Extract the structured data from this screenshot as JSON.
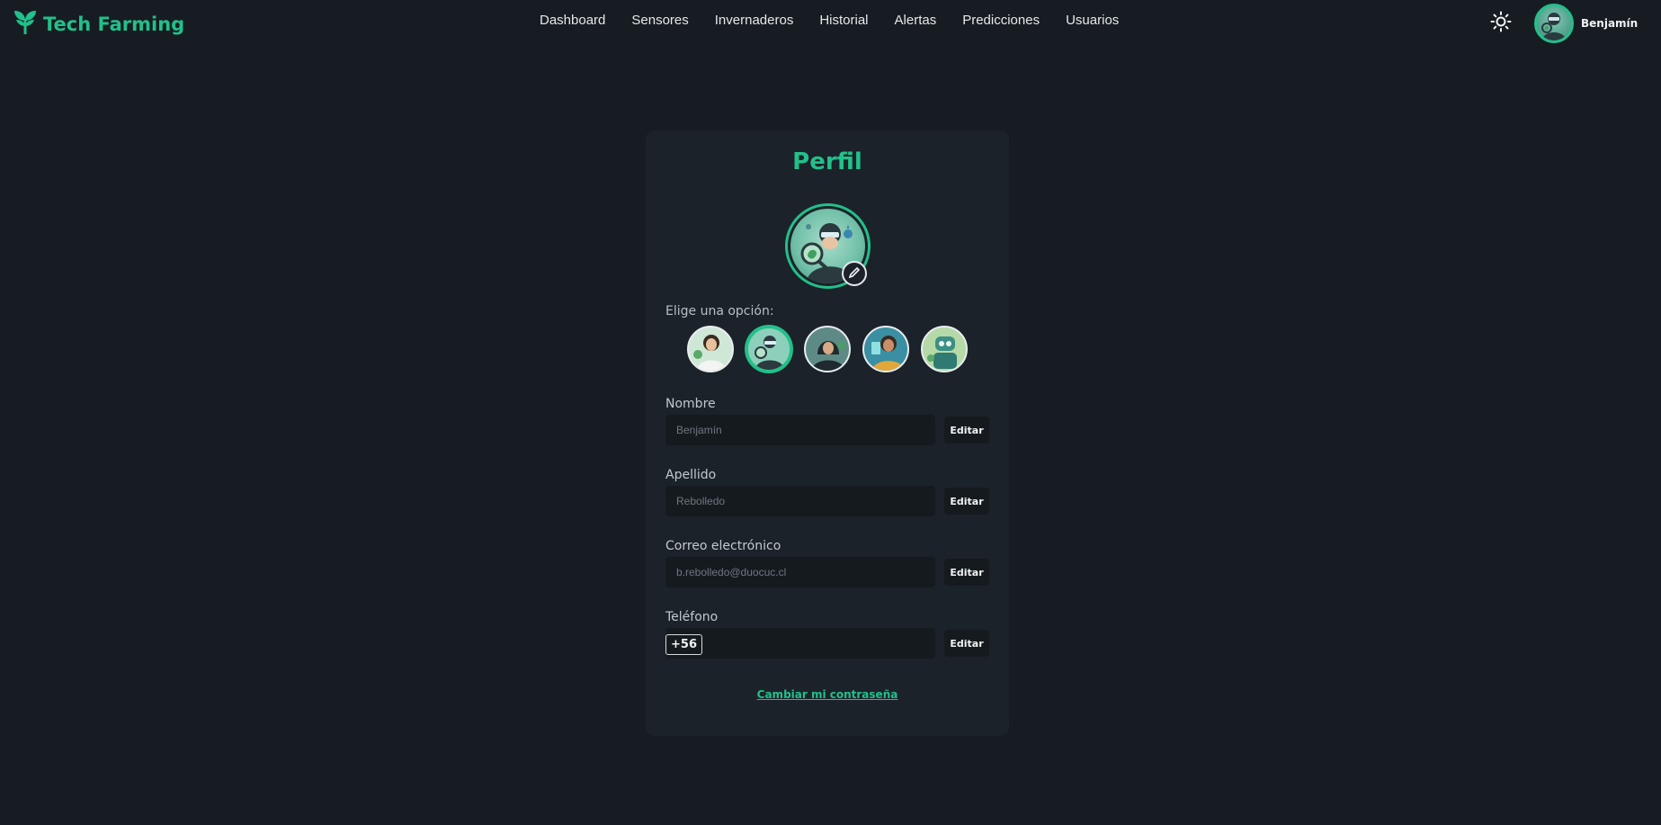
{
  "brand": {
    "name": "Tech Farming",
    "icon": "sprout-icon",
    "color": "#22c08a"
  },
  "nav": {
    "items": [
      {
        "label": "Dashboard"
      },
      {
        "label": "Sensores"
      },
      {
        "label": "Invernaderos"
      },
      {
        "label": "Historial"
      },
      {
        "label": "Alertas"
      },
      {
        "label": "Predicciones"
      },
      {
        "label": "Usuarios"
      }
    ]
  },
  "header": {
    "theme_icon": "sun-icon",
    "user_name": "Benjamín"
  },
  "profile": {
    "title": "Perfil",
    "choose_label": "Elige una opción:",
    "avatar_options": [
      {
        "name": "avatar-option-scientist-woman",
        "selected": false
      },
      {
        "name": "avatar-option-man-magnifier",
        "selected": true
      },
      {
        "name": "avatar-option-hooded-woman",
        "selected": false
      },
      {
        "name": "avatar-option-woman-tablet",
        "selected": false
      },
      {
        "name": "avatar-option-robot",
        "selected": false
      }
    ],
    "fields": {
      "nombre": {
        "label": "Nombre",
        "placeholder": "Benjamín",
        "edit": "Editar"
      },
      "apellido": {
        "label": "Apellido",
        "placeholder": "Rebolledo",
        "edit": "Editar"
      },
      "correo": {
        "label": "Correo electrónico",
        "placeholder": "b.rebolledo@duocuc.cl",
        "edit": "Editar"
      },
      "telefono": {
        "label": "Teléfono",
        "prefix": "+56",
        "edit": "Editar"
      }
    },
    "change_password": "Cambiar mi contraseña"
  },
  "colors": {
    "background": "#171c22",
    "card": "#1c2229",
    "accent": "#22c08a",
    "input": "#151a1f"
  }
}
